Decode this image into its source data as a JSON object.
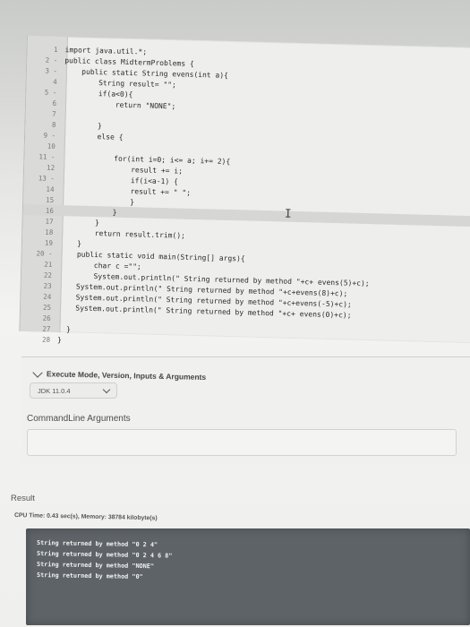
{
  "editor": {
    "lines": [
      {
        "num": "1",
        "text": "import java.util.*;"
      },
      {
        "num": "2 -",
        "text": "public class MidtermProblems {"
      },
      {
        "num": "3 -",
        "text": "    public static String evens(int a){"
      },
      {
        "num": "4",
        "text": "        String result= \"\";"
      },
      {
        "num": "5 -",
        "text": "        if(a<0){"
      },
      {
        "num": "6",
        "text": "            return \"NONE\";"
      },
      {
        "num": "7",
        "text": ""
      },
      {
        "num": "8",
        "text": "        }"
      },
      {
        "num": "9 -",
        "text": "        else {"
      },
      {
        "num": "10",
        "text": ""
      },
      {
        "num": "11 -",
        "text": "            for(int i=0; i<= a; i+= 2){"
      },
      {
        "num": "12",
        "text": "                result += i;"
      },
      {
        "num": "13 -",
        "text": "                if(i<a-1) {"
      },
      {
        "num": "14",
        "text": "                result += \" \";"
      },
      {
        "num": "15",
        "text": "                }"
      },
      {
        "num": "16",
        "text": "            }"
      },
      {
        "num": "17",
        "text": "        }"
      },
      {
        "num": "18",
        "text": "        return result.trim();"
      },
      {
        "num": "19",
        "text": "    }"
      },
      {
        "num": "20 -",
        "text": "    public static void main(String[] args){"
      },
      {
        "num": "21",
        "text": "        char c =\"\";"
      },
      {
        "num": "22",
        "text": "        System.out.println(\" String returned by method \"+c+ evens(5)+c);"
      },
      {
        "num": "23",
        "text": "    System.out.println(\" String returned by method \"+c+evens(8)+c);"
      },
      {
        "num": "24",
        "text": "    System.out.println(\" String returned by method \"+c+evens(-5)+c);"
      },
      {
        "num": "25",
        "text": "    System.out.println(\" String returned by method \"+c+ evens(0)+c);"
      },
      {
        "num": "26",
        "text": ""
      },
      {
        "num": "27",
        "text": "  }"
      },
      {
        "num": "28",
        "text": "}"
      }
    ]
  },
  "execution": {
    "section_title": "Execute Mode, Version, Inputs & Arguments",
    "jdk_version": "JDK 11.0.4",
    "command_label": "CommandLine Arguments",
    "command_value": ""
  },
  "result": {
    "title": "Result",
    "cpu_text": "CPU Time: 0.43 sec(s), Memory: 38784 kilobyte(s)",
    "output_lines": [
      "String returned by method \"0 2 4\"",
      "String returned by method \"0 2 4 6 8\"",
      "String returned by method \"NONE\"",
      "String returned by method \"0\""
    ]
  }
}
